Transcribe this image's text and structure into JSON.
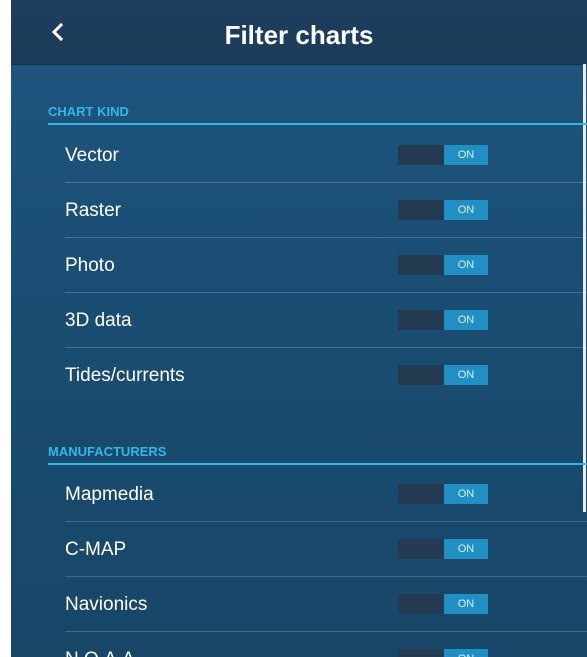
{
  "header": {
    "title": "Filter charts"
  },
  "sections": [
    {
      "title": "CHART KIND",
      "items": [
        {
          "label": "Vector",
          "state": "ON"
        },
        {
          "label": "Raster",
          "state": "ON"
        },
        {
          "label": "Photo",
          "state": "ON"
        },
        {
          "label": "3D data",
          "state": "ON"
        },
        {
          "label": "Tides/currents",
          "state": "ON"
        }
      ]
    },
    {
      "title": "MANUFACTURERS",
      "items": [
        {
          "label": "Mapmedia",
          "state": "ON"
        },
        {
          "label": "C-MAP",
          "state": "ON"
        },
        {
          "label": "Navionics",
          "state": "ON"
        },
        {
          "label": "N.O.A.A.",
          "state": "ON"
        }
      ]
    }
  ],
  "colors": {
    "accent": "#33b7e8",
    "toggle_on": "#1f8fc4",
    "header_bg": "#1d3f5e"
  }
}
